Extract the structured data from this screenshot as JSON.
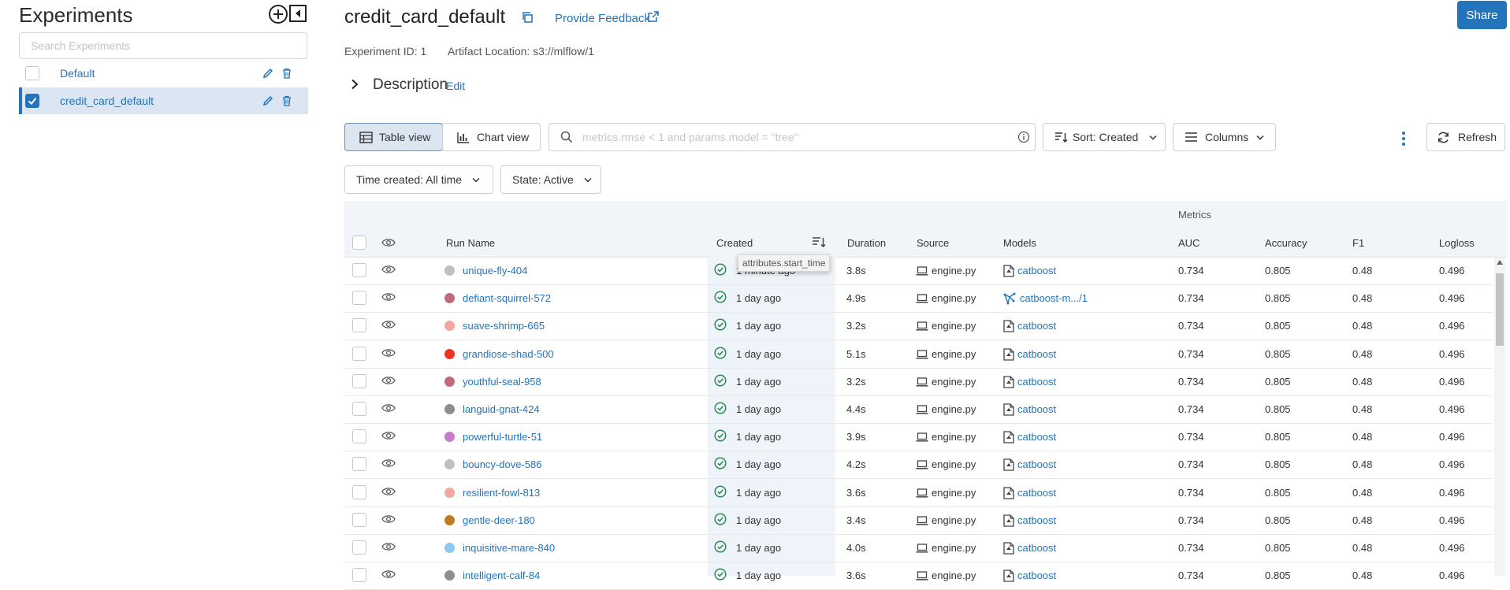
{
  "sidebar": {
    "title": "Experiments",
    "search_placeholder": "Search Experiments",
    "items": [
      {
        "label": "Default",
        "selected": false
      },
      {
        "label": "credit_card_default",
        "selected": true
      }
    ]
  },
  "header": {
    "title": "credit_card_default",
    "feedback": "Provide Feedback",
    "share": "Share",
    "experiment_id": "Experiment ID: 1",
    "artifact_location": "Artifact Location: s3://mlflow/1",
    "description": "Description",
    "edit": "Edit"
  },
  "toolbar": {
    "table_view": "Table view",
    "chart_view": "Chart view",
    "search_placeholder": "metrics.rmse < 1 and params.model = \"tree\"",
    "sort": "Sort: Created",
    "columns": "Columns",
    "refresh": "Refresh",
    "time_created": "Time created: All time",
    "state": "State: Active"
  },
  "table": {
    "group_header": "Metrics",
    "columns": {
      "run_name": "Run Name",
      "created": "Created",
      "duration": "Duration",
      "source": "Source",
      "models": "Models",
      "auc": "AUC",
      "accuracy": "Accuracy",
      "f1": "F1",
      "logloss": "Logloss"
    },
    "tooltip": "attributes.start_time",
    "rows": [
      {
        "name": "unique-fly-404",
        "color": "#c0c0c0",
        "created": "1 minute ago",
        "duration": "3.8s",
        "source": "engine.py",
        "model": "catboost",
        "model_type": "logged",
        "auc": "0.734",
        "accuracy": "0.805",
        "f1": "0.48",
        "logloss": "0.496"
      },
      {
        "name": "defiant-squirrel-572",
        "color": "#c06a7a",
        "created": "1 day ago",
        "duration": "4.9s",
        "source": "engine.py",
        "model": "catboost-m.../1",
        "model_type": "registered",
        "auc": "0.734",
        "accuracy": "0.805",
        "f1": "0.48",
        "logloss": "0.496"
      },
      {
        "name": "suave-shrimp-665",
        "color": "#f4a7a0",
        "created": "1 day ago",
        "duration": "3.2s",
        "source": "engine.py",
        "model": "catboost",
        "model_type": "logged",
        "auc": "0.734",
        "accuracy": "0.805",
        "f1": "0.48",
        "logloss": "0.496"
      },
      {
        "name": "grandiose-shad-500",
        "color": "#ee3322",
        "created": "1 day ago",
        "duration": "5.1s",
        "source": "engine.py",
        "model": "catboost",
        "model_type": "logged",
        "auc": "0.734",
        "accuracy": "0.805",
        "f1": "0.48",
        "logloss": "0.496"
      },
      {
        "name": "youthful-seal-958",
        "color": "#c06a7a",
        "created": "1 day ago",
        "duration": "3.2s",
        "source": "engine.py",
        "model": "catboost",
        "model_type": "logged",
        "auc": "0.734",
        "accuracy": "0.805",
        "f1": "0.48",
        "logloss": "0.496"
      },
      {
        "name": "languid-gnat-424",
        "color": "#8e8e8e",
        "created": "1 day ago",
        "duration": "4.4s",
        "source": "engine.py",
        "model": "catboost",
        "model_type": "logged",
        "auc": "0.734",
        "accuracy": "0.805",
        "f1": "0.48",
        "logloss": "0.496"
      },
      {
        "name": "powerful-turtle-51",
        "color": "#c77ccc",
        "created": "1 day ago",
        "duration": "3.9s",
        "source": "engine.py",
        "model": "catboost",
        "model_type": "logged",
        "auc": "0.734",
        "accuracy": "0.805",
        "f1": "0.48",
        "logloss": "0.496"
      },
      {
        "name": "bouncy-dove-586",
        "color": "#c0c0c0",
        "created": "1 day ago",
        "duration": "4.2s",
        "source": "engine.py",
        "model": "catboost",
        "model_type": "logged",
        "auc": "0.734",
        "accuracy": "0.805",
        "f1": "0.48",
        "logloss": "0.496"
      },
      {
        "name": "resilient-fowl-813",
        "color": "#f4a7a0",
        "created": "1 day ago",
        "duration": "3.6s",
        "source": "engine.py",
        "model": "catboost",
        "model_type": "logged",
        "auc": "0.734",
        "accuracy": "0.805",
        "f1": "0.48",
        "logloss": "0.496"
      },
      {
        "name": "gentle-deer-180",
        "color": "#c17a22",
        "created": "1 day ago",
        "duration": "3.4s",
        "source": "engine.py",
        "model": "catboost",
        "model_type": "logged",
        "auc": "0.734",
        "accuracy": "0.805",
        "f1": "0.48",
        "logloss": "0.496"
      },
      {
        "name": "inquisitive-mare-840",
        "color": "#8ec8ee",
        "created": "1 day ago",
        "duration": "4.0s",
        "source": "engine.py",
        "model": "catboost",
        "model_type": "logged",
        "auc": "0.734",
        "accuracy": "0.805",
        "f1": "0.48",
        "logloss": "0.496"
      },
      {
        "name": "intelligent-calf-84",
        "color": "#8e8e8e",
        "created": "1 day ago",
        "duration": "3.6s",
        "source": "engine.py",
        "model": "catboost",
        "model_type": "logged",
        "auc": "0.734",
        "accuracy": "0.805",
        "f1": "0.48",
        "logloss": "0.496"
      }
    ]
  },
  "icons": [
    "add-experiment-icon",
    "collapse-sidebar-icon",
    "edit-icon",
    "trash-icon",
    "copy-icon",
    "external-link-icon",
    "chevron-right-icon",
    "table-icon",
    "bar-chart-icon",
    "search-icon",
    "info-icon",
    "sort-icon",
    "columns-icon",
    "chevron-down-icon",
    "kebab-menu-icon",
    "refresh-icon",
    "eye-icon",
    "check-circle-icon",
    "laptop-icon",
    "model-file-icon",
    "registered-model-icon"
  ],
  "colors": {
    "accent": "#2374bb",
    "selected_bg": "#dbe6f2",
    "table_header_bg": "#f1f5f9",
    "success": "#2e8b57"
  }
}
